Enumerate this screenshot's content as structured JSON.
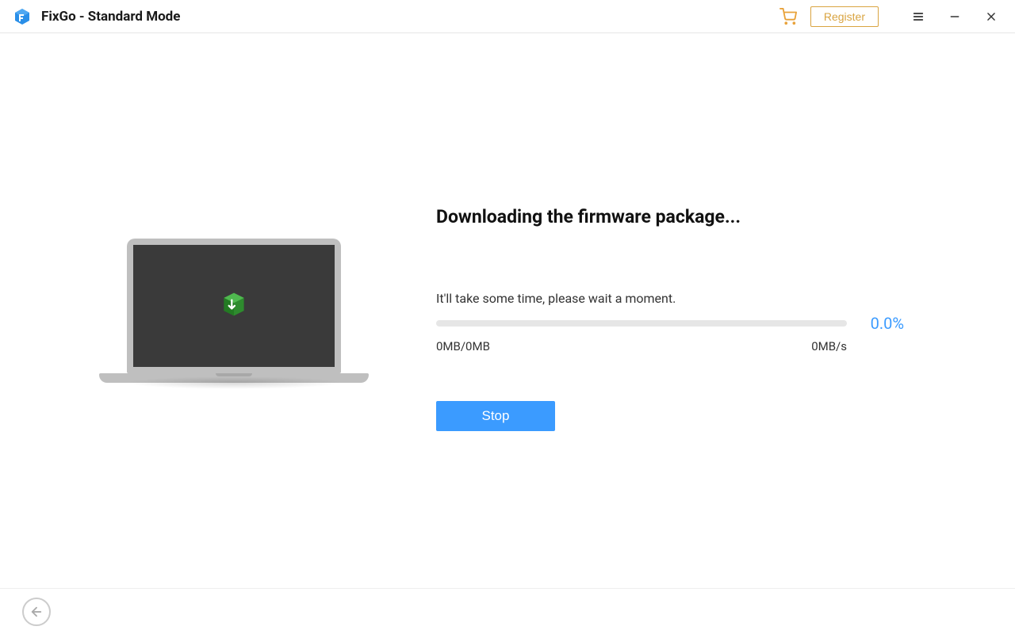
{
  "app": {
    "title": "FixGo - Standard Mode"
  },
  "titlebar": {
    "register_label": "Register"
  },
  "download": {
    "heading": "Downloading the firmware package...",
    "subtext": "It'll take some time, please wait a moment.",
    "percent": "0.0%",
    "size_stat": "0MB/0MB",
    "speed_stat": "0MB/s",
    "stop_label": "Stop"
  },
  "colors": {
    "accent": "#3b9bff",
    "register_border": "#d9a441"
  }
}
